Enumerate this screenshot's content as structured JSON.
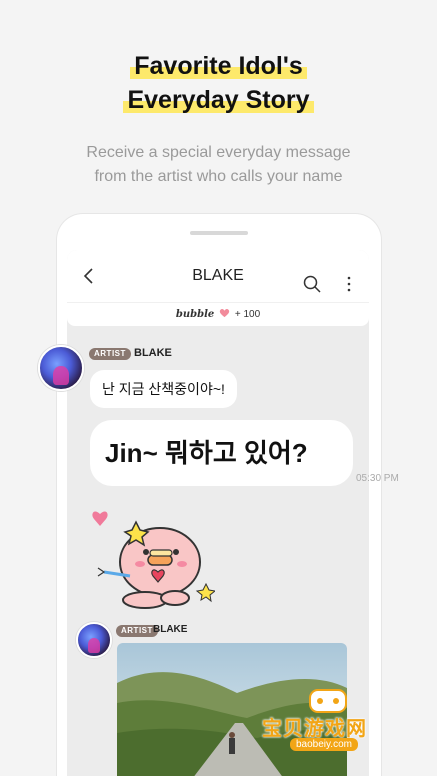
{
  "headline": {
    "line1": "Favorite Idol's",
    "line2": "Everyday Story",
    "highlight_color": "#fde96b"
  },
  "subtitle": {
    "line1": "Receive a special everyday message",
    "line2": "from the artist who calls your name"
  },
  "chat": {
    "header_title": "BLAKE",
    "back_icon": "back-arrow-icon",
    "search_icon": "search-icon",
    "more_icon": "more-vertical-icon",
    "bubble_bar": {
      "logo": "bubble",
      "count": "+ 100",
      "heart_color": "#f28b9b"
    },
    "messages": [
      {
        "badge": "ARTIST",
        "sender": "BLAKE",
        "text": "난 지금 산책중이야~!"
      },
      {
        "text": "Jin~ 뭐하고 있어?",
        "time": "05:30 PM"
      }
    ],
    "second_group": {
      "badge": "ARTIST",
      "sender": "BLAKE"
    }
  },
  "watermark": {
    "text": "宝贝游戏网",
    "url": "baobeiy.com",
    "color": "#f2a516"
  }
}
